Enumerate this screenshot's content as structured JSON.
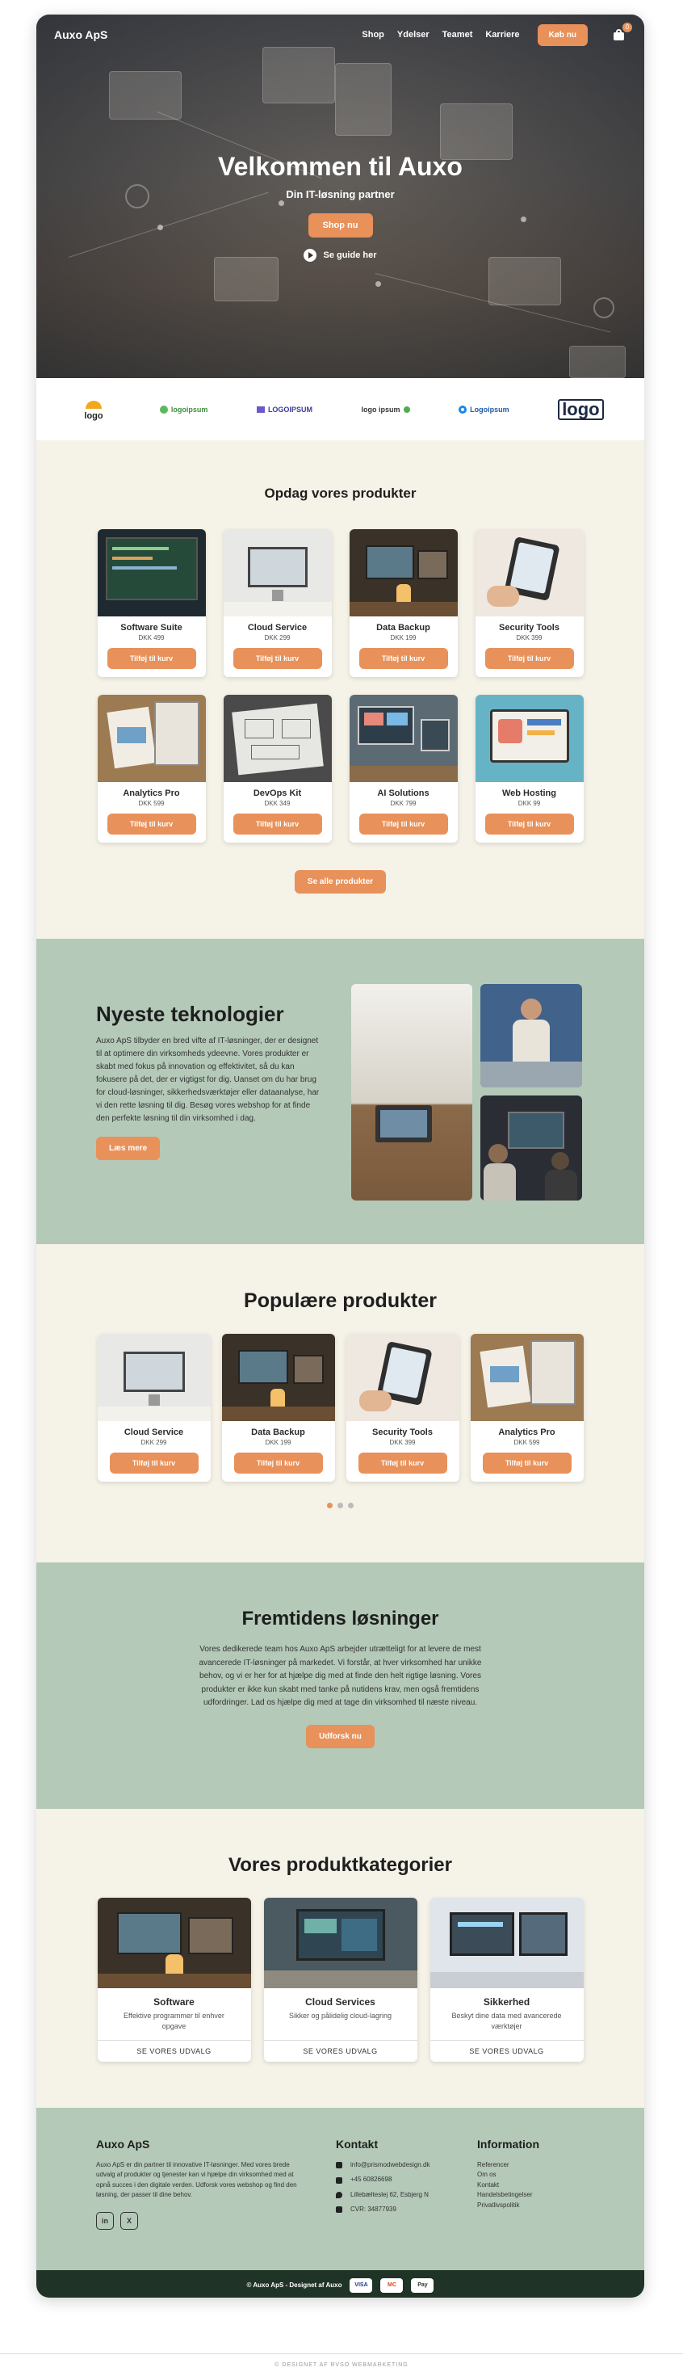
{
  "nav": {
    "brand": "Auxo ApS",
    "links": [
      "Shop",
      "Ydelser",
      "Teamet",
      "Karriere"
    ],
    "cta": "Køb nu",
    "cart_count": "0"
  },
  "hero": {
    "title": "Velkommen til Auxo",
    "subtitle": "Din IT-løsning partner",
    "cta": "Shop nu",
    "guide": "Se guide her"
  },
  "logos": [
    "logo",
    "logoipsum",
    "LOGOIPSUM",
    "logo ipsum",
    "Logoipsum",
    "logo"
  ],
  "products": {
    "title": "Opdag vores produkter",
    "items": [
      {
        "name": "Software Suite",
        "price": "DKK 499",
        "button": "Tilføj til kurv"
      },
      {
        "name": "Cloud Service",
        "price": "DKK 299",
        "button": "Tilføj til kurv"
      },
      {
        "name": "Data Backup",
        "price": "DKK 199",
        "button": "Tilføj til kurv"
      },
      {
        "name": "Security Tools",
        "price": "DKK 399",
        "button": "Tilføj til kurv"
      },
      {
        "name": "Analytics Pro",
        "price": "DKK 599",
        "button": "Tilføj til kurv"
      },
      {
        "name": "DevOps Kit",
        "price": "DKK 349",
        "button": "Tilføj til kurv"
      },
      {
        "name": "AI Solutions",
        "price": "DKK 799",
        "button": "Tilføj til kurv"
      },
      {
        "name": "Web Hosting",
        "price": "DKK 99",
        "button": "Tilføj til kurv"
      }
    ],
    "all_button": "Se alle produkter"
  },
  "tech": {
    "title": "Nyeste teknologier",
    "body": "Auxo ApS tilbyder en bred vifte af IT-løsninger, der er designet til at optimere din virksomheds ydeevne. Vores produkter er skabt med fokus på innovation og effektivitet, så du kan fokusere på det, der er vigtigst for dig. Uanset om du har brug for cloud-løsninger, sikkerhedsværktøjer eller dataanalyse, har vi den rette løsning til dig. Besøg vores webshop for at finde den perfekte løsning til din virksomhed i dag.",
    "button": "Læs mere"
  },
  "popular": {
    "title": "Populære produkter",
    "items": [
      {
        "name": "Cloud Service",
        "price": "DKK 299",
        "button": "Tilføj til kurv"
      },
      {
        "name": "Data Backup",
        "price": "DKK 199",
        "button": "Tilføj til kurv"
      },
      {
        "name": "Security Tools",
        "price": "DKK 399",
        "button": "Tilføj til kurv"
      },
      {
        "name": "Analytics Pro",
        "price": "DKK 599",
        "button": "Tilføj til kurv"
      }
    ]
  },
  "future": {
    "title": "Fremtidens løsninger",
    "body": "Vores dedikerede team hos Auxo ApS arbejder utrætteligt for at levere de mest avancerede IT-løsninger på markedet. Vi forstår, at hver virksomhed har unikke behov, og vi er her for at hjælpe dig med at finde den helt rigtige løsning. Vores produkter er ikke kun skabt med tanke på nutidens krav, men også fremtidens udfordringer. Lad os hjælpe dig med at tage din virksomhed til næste niveau.",
    "button": "Udforsk nu"
  },
  "categories": {
    "title": "Vores produktkategorier",
    "items": [
      {
        "name": "Software",
        "desc": "Effektive programmer til enhver opgave",
        "link": "SE VORES UDVALG"
      },
      {
        "name": "Cloud Services",
        "desc": "Sikker og pålidelig cloud-lagring",
        "link": "SE VORES UDVALG"
      },
      {
        "name": "Sikkerhed",
        "desc": "Beskyt dine data med avancerede værktøjer",
        "link": "SE VORES UDVALG"
      }
    ]
  },
  "footer": {
    "about_title": "Auxo ApS",
    "about_text": "Auxo ApS er din partner til innovative IT-løsninger. Med vores brede udvalg af produkter og tjenester kan vi hjælpe din virksomhed med at opnå succes i den digitale verden. Udforsk vores webshop og find den løsning, der passer til dine behov.",
    "social": [
      "in",
      "X"
    ],
    "contact_title": "Kontakt",
    "contact": [
      "info@prismodwebdesign.dk",
      "+45 60826698",
      "Lillebælteslej 62, Esbjerg N",
      "CVR: 34877939"
    ],
    "info_title": "Information",
    "info_links": [
      "Referencer",
      "Om os",
      "Kontakt",
      "Handelsbetingelser",
      "Privatlivspolitik"
    ],
    "copyright": "© Auxo ApS - Designet af Auxo",
    "payment": [
      "VISA",
      "MC",
      "Pay"
    ]
  },
  "credit": "© DESIGNET AF RVSO WEBMARKETING",
  "colors": {
    "accent": "#e8915a",
    "sage": "#b4c9b8",
    "cream": "#f5f2e8",
    "dark": "#1f3326"
  }
}
